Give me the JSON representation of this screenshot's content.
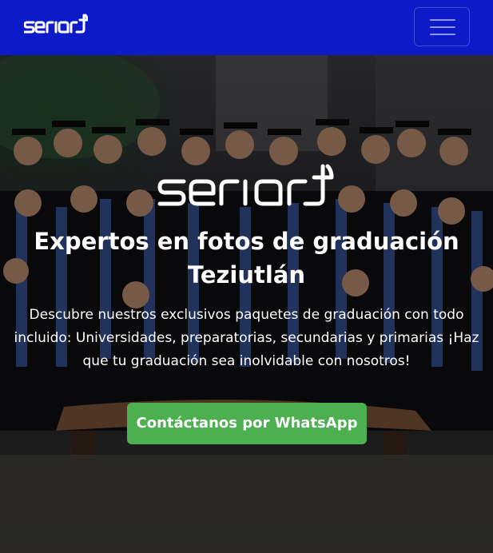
{
  "navbar": {
    "logo_text": "seriart",
    "menu_button_icon": "hamburger-menu-icon",
    "background_color": "#0c1bc7"
  },
  "hero": {
    "logo_text": "seriart",
    "title_line1": "Expertos en fotos de graduación",
    "title_line2": "Teziutlán",
    "description": "Descubre nuestros exclusivos paquetes de graduación con todo incluido: Universidades, preparatorias, secundarias y primarias ¡Haz que tu graduación sea inolvidable con nosotros!",
    "cta_label": "Contáctanos por WhatsApp",
    "cta_color": "#4caf50"
  }
}
